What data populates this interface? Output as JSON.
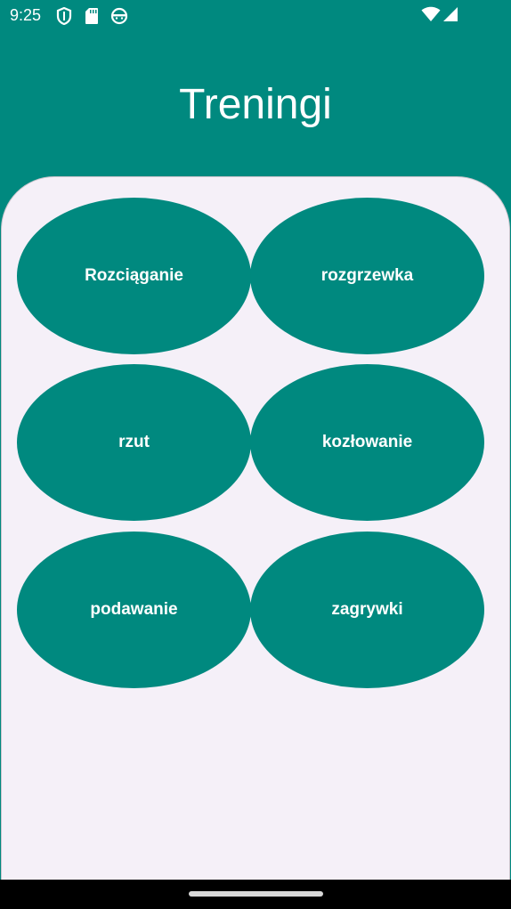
{
  "status_bar": {
    "time": "9:25",
    "left_icons": [
      "shield-icon",
      "sd-card-icon",
      "android-face-icon"
    ],
    "right_icons": [
      "wifi-icon",
      "signal-icon"
    ]
  },
  "header": {
    "title": "Treningi"
  },
  "trainings": [
    {
      "label": "Rozciąganie"
    },
    {
      "label": "rozgrzewka"
    },
    {
      "label": "rzut"
    },
    {
      "label": "kozłowanie"
    },
    {
      "label": "podawanie"
    },
    {
      "label": "zagrywki"
    }
  ],
  "colors": {
    "primary": "#00897f",
    "surface": "#f5f0f8",
    "on_primary": "#ffffff",
    "nav_bar": "#000000"
  }
}
